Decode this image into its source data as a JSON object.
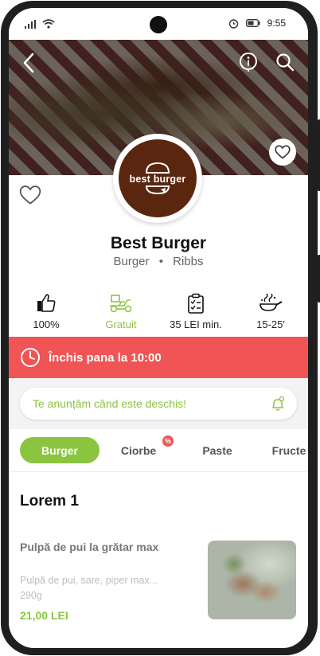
{
  "status_bar": {
    "time": "9:55",
    "icons": [
      "signal-icon",
      "wifi-icon",
      "alarm-icon",
      "battery-icon"
    ]
  },
  "header": {
    "icons": [
      "back-arrow-icon",
      "info-icon",
      "search-icon",
      "heart-icon"
    ]
  },
  "restaurant": {
    "logo_text": "best burger",
    "name": "Best Burger",
    "tags": [
      "Burger",
      "Ribbs"
    ],
    "tag_separator": "•"
  },
  "info": [
    {
      "icon": "thumbs-up-icon",
      "label": "100%"
    },
    {
      "icon": "delivery-scooter-icon",
      "label": "Gratuit",
      "color": "#8bc53f"
    },
    {
      "icon": "checklist-icon",
      "label": "35 LEI min."
    },
    {
      "icon": "cooking-pan-icon",
      "label": "15-25'"
    }
  ],
  "closed_banner": {
    "text": "Închis pana la 10:00",
    "color": "#f05454"
  },
  "notify": {
    "text": "Te anunțăm când este deschis!"
  },
  "tabs": [
    {
      "label": "Burger",
      "active": true
    },
    {
      "label": "Ciorbe",
      "badge": "%"
    },
    {
      "label": "Paste"
    },
    {
      "label": "Fructe"
    }
  ],
  "section": {
    "title": "Lorem 1"
  },
  "product": {
    "name": "Pulpă de pui la grătar max",
    "description": "Pulpă de pui, sare, piper max...",
    "weight": "290g",
    "price": "21,00 LEI"
  },
  "colors": {
    "accent": "#8bc53f",
    "alert": "#f05454",
    "logo_bg": "#5a260f"
  }
}
